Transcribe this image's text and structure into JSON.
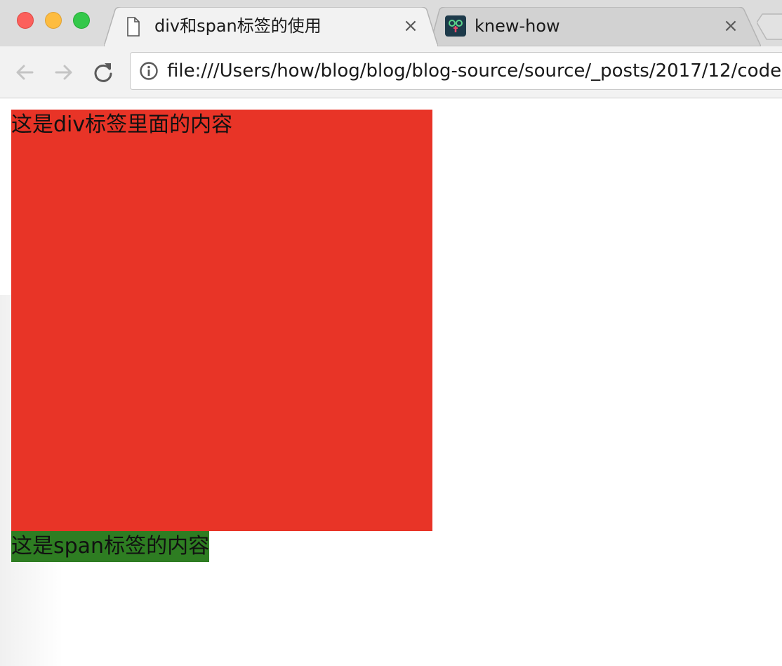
{
  "tabs": [
    {
      "title": "div和span标签的使用",
      "active": true,
      "icon": "file-icon"
    },
    {
      "title": "knew-how",
      "active": false,
      "icon": "knew-how-favicon"
    }
  ],
  "tab_close_glyph": "×",
  "address_bar": {
    "url": "file:///Users/how/blog/blog/blog-source/source/_posts/2017/12/code"
  },
  "page": {
    "div_text": "这是div标签里面的内容",
    "span_text": "这是span标签的内容"
  },
  "colors": {
    "div_background": "#e83427",
    "span_background": "#2e7d22"
  }
}
